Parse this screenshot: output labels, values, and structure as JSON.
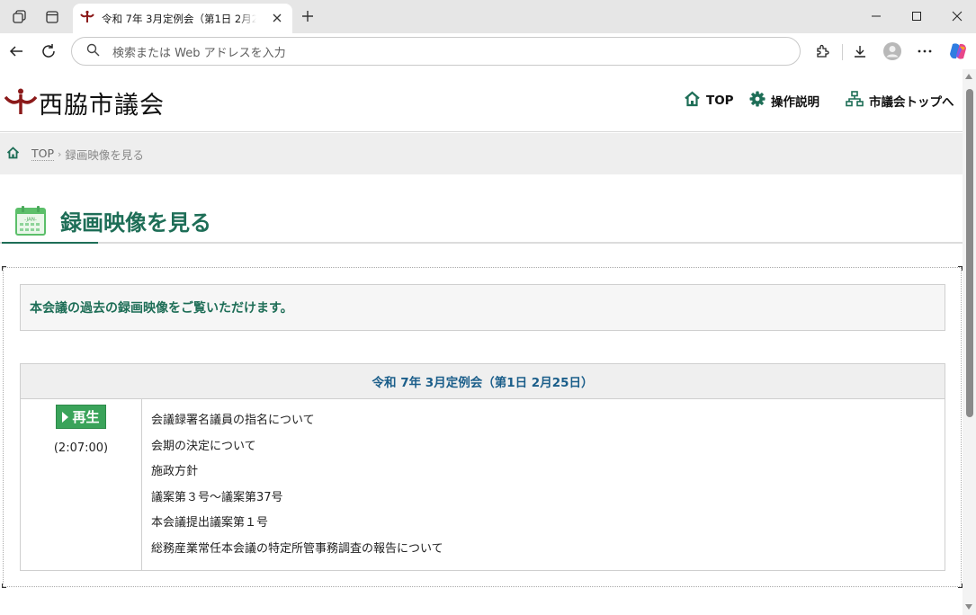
{
  "browser": {
    "tab_title": "令和 7年 3月定例会（第1日 2月25日）",
    "address_placeholder": "検索または Web アドレスを入力"
  },
  "site": {
    "logo_text": "西脇市議会",
    "nav": [
      {
        "label": "TOP",
        "icon": "home-icon"
      },
      {
        "label": "操作説明",
        "icon": "gear-icon"
      },
      {
        "label": "市議会トップへ",
        "icon": "sitemap-icon"
      }
    ]
  },
  "breadcrumb": {
    "top": "TOP",
    "separator": "›",
    "current": "録画映像を見る"
  },
  "page": {
    "title": "録画映像を見る",
    "calendar_label": "-JAN-",
    "notice": "本会議の過去の録画映像をご覧いただけます。"
  },
  "session": {
    "title": "令和 7年 3月定例会（第1日 2月25日）",
    "play_label": "再生",
    "duration": "(2:07:00)",
    "items": [
      "会議録署名議員の指名について",
      "会期の決定について",
      "施政方針",
      "議案第３号～議案第37号",
      "本会議提出議案第１号",
      "総務産業常任本会議の特定所管事務調査の報告について"
    ]
  },
  "colors": {
    "accent_green": "#1e6e57",
    "play_green": "#3aa35a",
    "session_blue": "#1b5e8a",
    "logo_red": "#8b1a1a"
  }
}
